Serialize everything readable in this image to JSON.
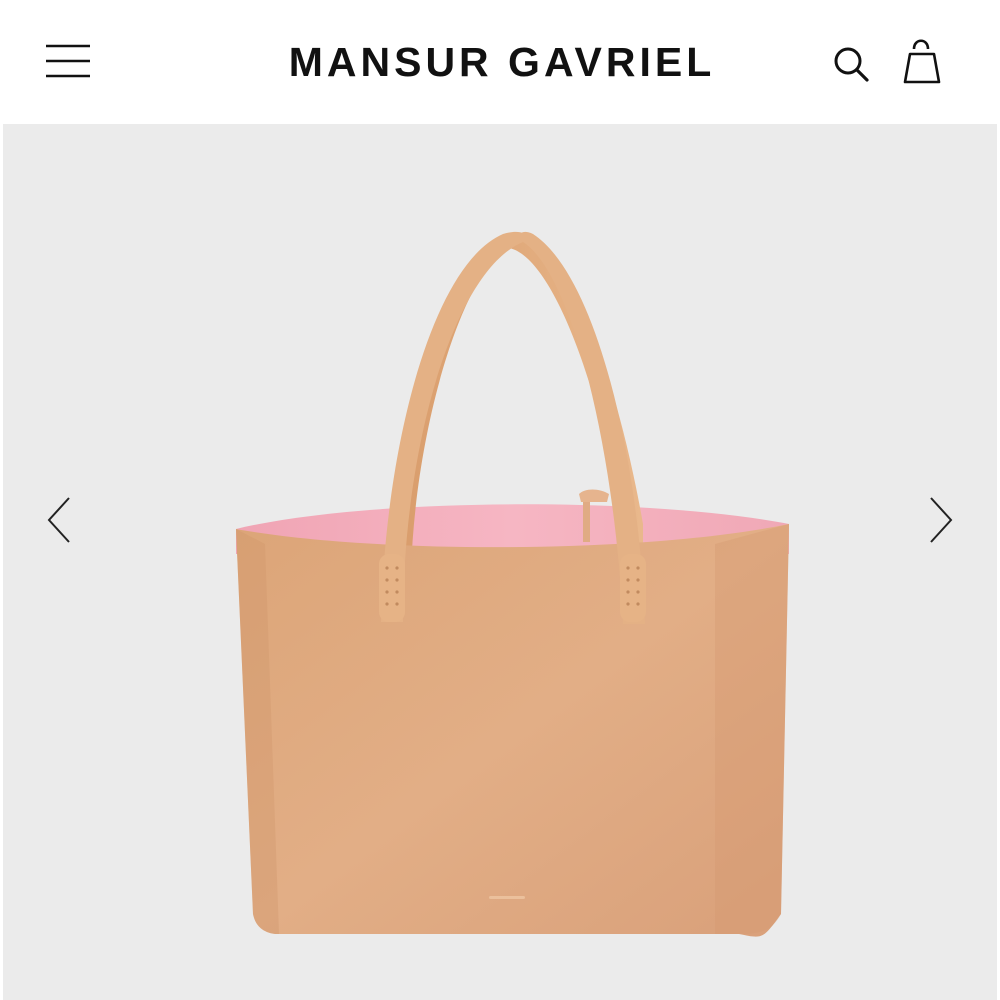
{
  "header": {
    "brand": "MANSUR GAVRIEL",
    "menu_icon": "hamburger-menu-icon",
    "search_icon": "search-icon",
    "bag_icon": "shopping-bag-icon"
  },
  "gallery": {
    "image": "product-photo-tote-bag",
    "prev_icon": "chevron-left-icon",
    "next_icon": "chevron-right-icon"
  },
  "colors": {
    "background": "#ffffff",
    "gallery_bg": "#ebebeb",
    "text": "#111111",
    "leather": "#dca67a",
    "lining": "#f2aab8"
  }
}
